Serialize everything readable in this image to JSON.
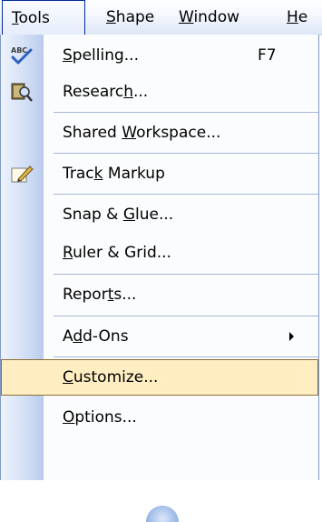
{
  "menubar": {
    "items": [
      {
        "label": "Tools",
        "accel_index": 0
      },
      {
        "label": "Shape"
      },
      {
        "label": "Window"
      },
      {
        "label": "Help"
      }
    ]
  },
  "menu": {
    "items": [
      {
        "id": "spelling",
        "label": "Spelling...",
        "shortcut": "F7",
        "icon": "spelling-abc-check-icon"
      },
      {
        "id": "research",
        "label": "Research...",
        "icon": "research-book-icon"
      },
      {
        "id": "shared-workspace",
        "label": "Shared Workspace..."
      },
      {
        "id": "track-markup",
        "label": "Track Markup",
        "icon": "track-markup-pencil-icon"
      },
      {
        "id": "snap-glue",
        "label": "Snap & Glue..."
      },
      {
        "id": "ruler-grid",
        "label": "Ruler & Grid..."
      },
      {
        "id": "reports",
        "label": "Reports..."
      },
      {
        "id": "add-ons",
        "label": "Add-Ons",
        "submenu": true
      },
      {
        "id": "customize",
        "label": "Customize...",
        "highlighted": true
      },
      {
        "id": "options",
        "label": "Options..."
      }
    ]
  },
  "colors": {
    "highlight_bg": "#ffeec2",
    "highlight_border": "#8a6e38",
    "active_border": "#002d96"
  }
}
